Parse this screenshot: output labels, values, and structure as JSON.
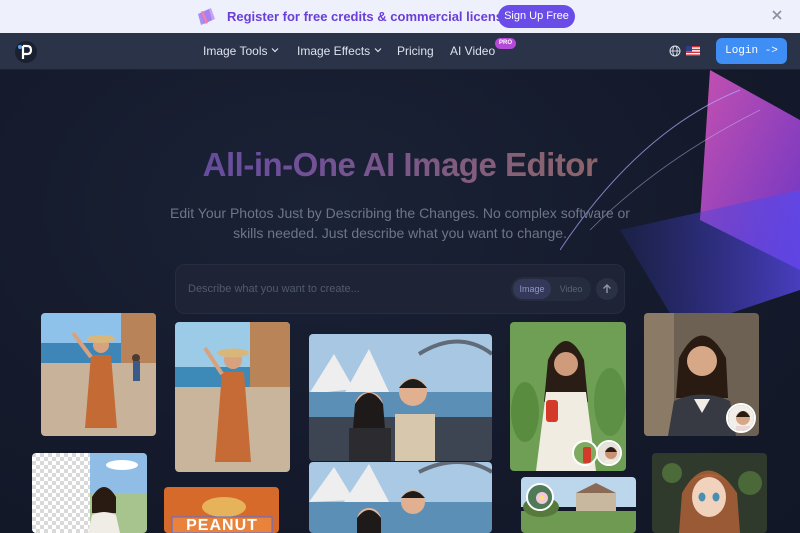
{
  "promo": {
    "text": "Register for free credits & commercial license",
    "cta": "Sign Up Free"
  },
  "nav": {
    "items": [
      {
        "label": "Image Tools",
        "dropdown": true
      },
      {
        "label": "Image Effects",
        "dropdown": true
      },
      {
        "label": "Pricing",
        "dropdown": false
      },
      {
        "label": "AI Video",
        "dropdown": false
      }
    ],
    "pro_badge": "PRO",
    "login": "Login ->"
  },
  "hero": {
    "title": "All-in-One AI Image Editor",
    "subtitle": "Edit Your Photos Just by Describing the Changes. No complex software or skills needed. Just describe what you want to change."
  },
  "prompt": {
    "placeholder": "Describe what you want to create...",
    "mode_options": [
      "Image",
      "Video"
    ],
    "selected_mode": "Image"
  },
  "card_text": {
    "peanut": "PEANUT"
  },
  "colors": {
    "accent": "#3e8ef5",
    "promo_button": "#6a4ce8",
    "background": "#141a2c"
  }
}
